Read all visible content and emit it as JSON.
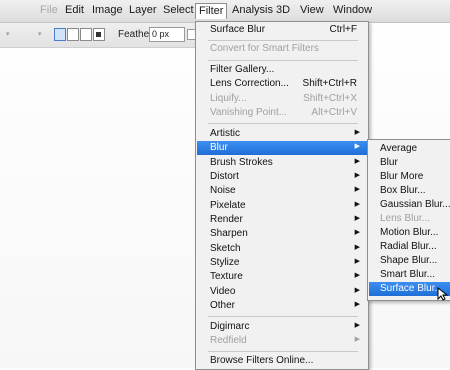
{
  "menubar": {
    "items": [
      "File",
      "Edit",
      "Image",
      "Layer",
      "Select",
      "Filter",
      "Analysis",
      "3D",
      "View",
      "Window"
    ],
    "active": "Filter"
  },
  "options_bar": {
    "feather_label": "Feather:",
    "feather_value": "0 px"
  },
  "filter_menu": {
    "items": [
      {
        "label": "Surface Blur",
        "shortcut": "Ctrl+F",
        "enabled": true
      },
      {
        "label": "Convert for Smart Filters",
        "enabled": false
      },
      {
        "label": "Filter Gallery...",
        "enabled": true
      },
      {
        "label": "Lens Correction...",
        "shortcut": "Shift+Ctrl+R",
        "enabled": true
      },
      {
        "label": "Liquify...",
        "shortcut": "Shift+Ctrl+X",
        "enabled": false
      },
      {
        "label": "Vanishing Point...",
        "shortcut": "Alt+Ctrl+V",
        "enabled": false
      },
      {
        "label": "Artistic",
        "submenu": true
      },
      {
        "label": "Blur",
        "submenu": true,
        "highlighted": true
      },
      {
        "label": "Brush Strokes",
        "submenu": true
      },
      {
        "label": "Distort",
        "submenu": true
      },
      {
        "label": "Noise",
        "submenu": true
      },
      {
        "label": "Pixelate",
        "submenu": true
      },
      {
        "label": "Render",
        "submenu": true
      },
      {
        "label": "Sharpen",
        "submenu": true
      },
      {
        "label": "Sketch",
        "submenu": true
      },
      {
        "label": "Stylize",
        "submenu": true
      },
      {
        "label": "Texture",
        "submenu": true
      },
      {
        "label": "Video",
        "submenu": true
      },
      {
        "label": "Other",
        "submenu": true
      },
      {
        "label": "Digimarc",
        "submenu": true
      },
      {
        "label": "Redfield",
        "submenu": true,
        "enabled": false
      },
      {
        "label": "Browse Filters Online...",
        "enabled": true
      }
    ]
  },
  "blur_submenu": {
    "items": [
      {
        "label": "Average",
        "enabled": true
      },
      {
        "label": "Blur",
        "enabled": true
      },
      {
        "label": "Blur More",
        "enabled": true
      },
      {
        "label": "Box Blur...",
        "enabled": true
      },
      {
        "label": "Gaussian Blur...",
        "enabled": true
      },
      {
        "label": "Lens Blur...",
        "enabled": false
      },
      {
        "label": "Motion Blur...",
        "enabled": true
      },
      {
        "label": "Radial Blur...",
        "enabled": true
      },
      {
        "label": "Shape Blur...",
        "enabled": true
      },
      {
        "label": "Smart Blur...",
        "enabled": true
      },
      {
        "label": "Surface Blur...",
        "enabled": true,
        "highlighted": true
      }
    ]
  },
  "colors": {
    "highlight": "#2a7de1",
    "disabled_text": "#a0a0a0",
    "menu_background": "#f1f1f1"
  },
  "icons": {
    "submenu_arrow": "triangle-right-icon",
    "cursor": "mouse-pointer-icon"
  }
}
